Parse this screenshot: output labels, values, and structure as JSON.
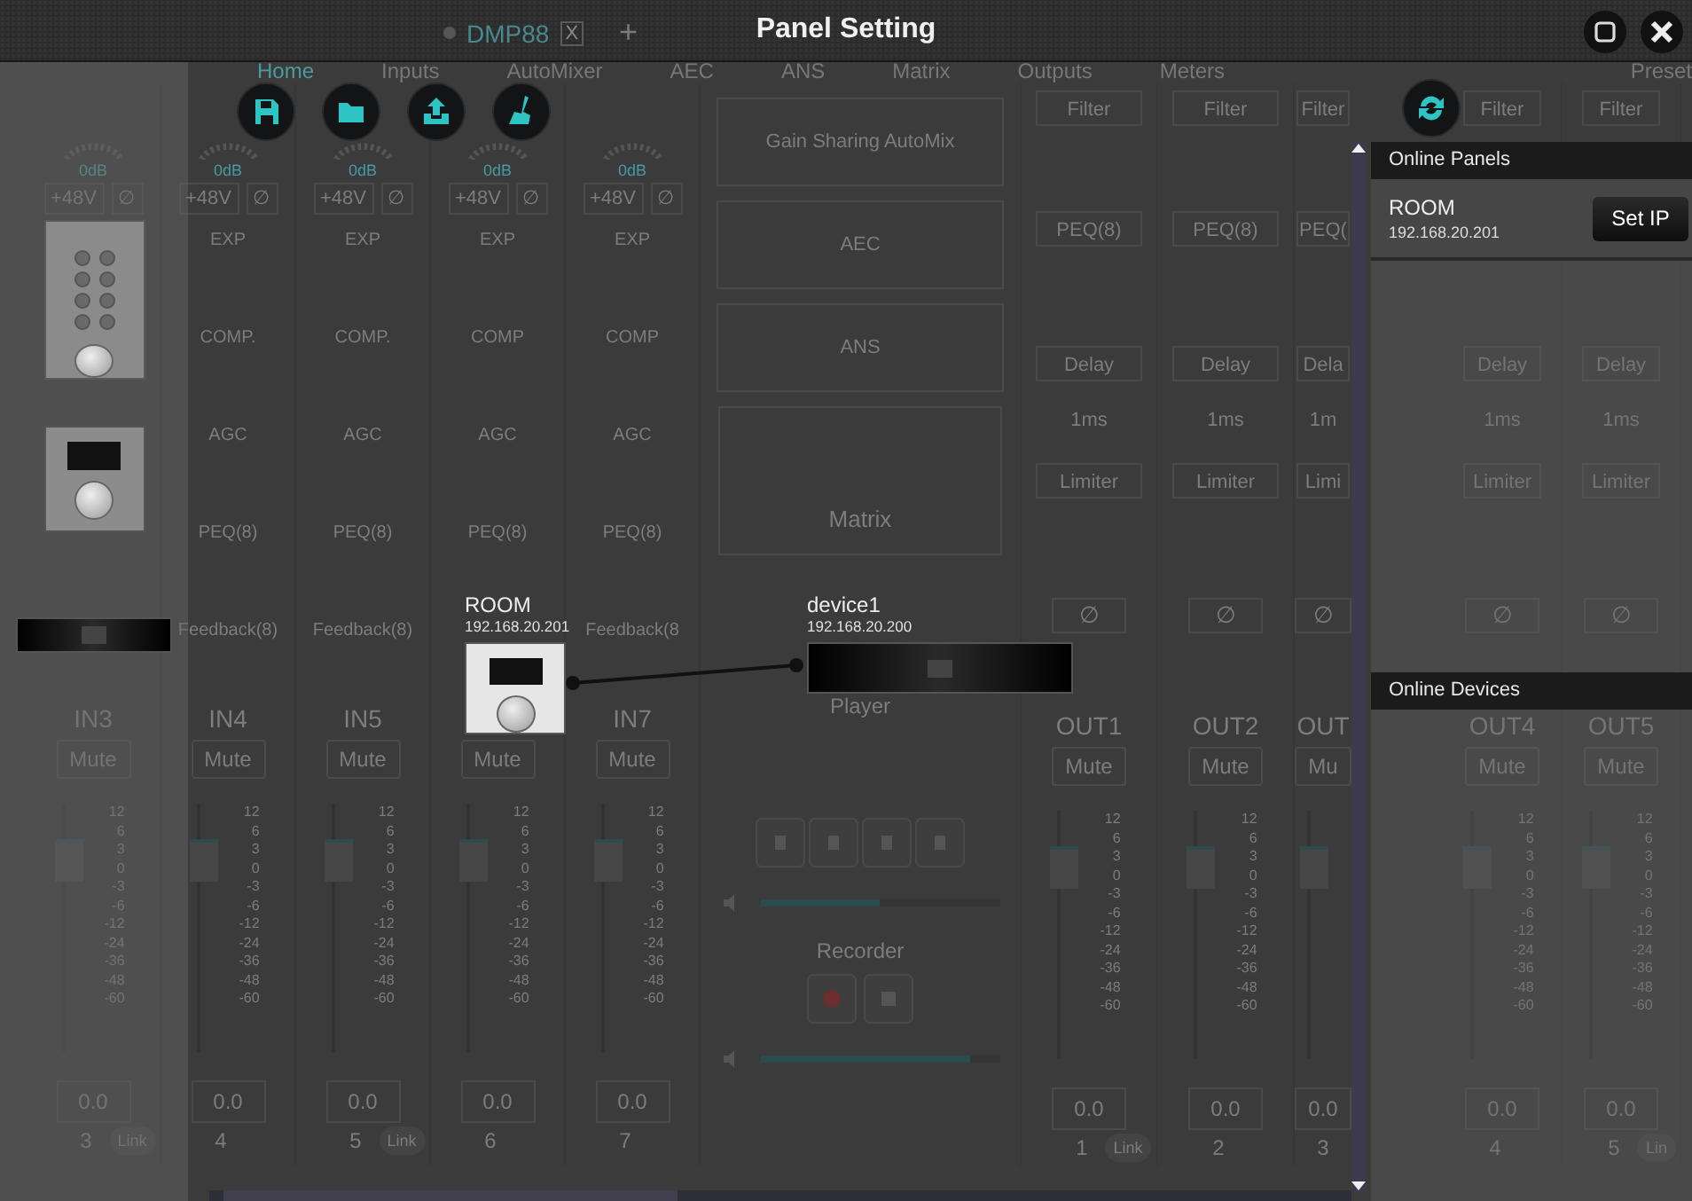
{
  "window": {
    "title": "Panel Setting"
  },
  "background_app": {
    "document_tab": {
      "label": "DMP88",
      "close": "X",
      "add": "+"
    },
    "tabs": [
      {
        "label": "Home",
        "selected": true
      },
      {
        "label": "Inputs",
        "selected": false
      },
      {
        "label": "AutoMixer",
        "selected": false
      },
      {
        "label": "AEC",
        "selected": false
      },
      {
        "label": "ANS",
        "selected": false
      },
      {
        "label": "Matrix",
        "selected": false
      },
      {
        "label": "Outputs",
        "selected": false
      },
      {
        "label": "Meters",
        "selected": false
      },
      {
        "label": "Preset",
        "selected": false
      }
    ],
    "input_strips": [
      {
        "gain": "0dB",
        "phantom": "+48V",
        "phase": "∅",
        "name": "IN3",
        "mute": "Mute",
        "scale": [
          "12",
          "6",
          "3",
          "0",
          "-3",
          "-6",
          "-12",
          "-24",
          "-36",
          "-48",
          "-60"
        ],
        "value": "0.0",
        "number": "3",
        "link": "Link"
      },
      {
        "gain": "0dB",
        "phantom": "+48V",
        "phase": "∅",
        "modules": [
          "EXP",
          "COMP.",
          "AGC",
          "PEQ(8)",
          "Feedback(8)"
        ],
        "name": "IN4",
        "mute": "Mute",
        "scale": [
          "12",
          "6",
          "3",
          "0",
          "-3",
          "-6",
          "-12",
          "-24",
          "-36",
          "-48",
          "-60"
        ],
        "value": "0.0",
        "number": "4"
      },
      {
        "gain": "0dB",
        "phantom": "+48V",
        "phase": "∅",
        "modules": [
          "EXP",
          "COMP.",
          "AGC",
          "PEQ(8)",
          "Feedback(8)"
        ],
        "name": "IN5",
        "mute": "Mute",
        "scale": [
          "12",
          "6",
          "3",
          "0",
          "-3",
          "-6",
          "-12",
          "-24",
          "-36",
          "-48",
          "-60"
        ],
        "value": "0.0",
        "number": "5",
        "link": "Link"
      },
      {
        "gain": "0dB",
        "phantom": "+48V",
        "phase": "∅",
        "modules": [
          "EXP",
          "COMP",
          "AGC",
          "PEQ(8)"
        ],
        "mute": "Mute",
        "scale": [
          "12",
          "6",
          "3",
          "0",
          "-3",
          "-6",
          "-12",
          "-24",
          "-36",
          "-48",
          "-60"
        ],
        "value": "0.0",
        "number": "6"
      },
      {
        "gain": "0dB",
        "phantom": "+48V",
        "phase": "∅",
        "modules": [
          "EXP",
          "COMP",
          "AGC",
          "PEQ(8)",
          "Feedback(8"
        ],
        "name": "IN7",
        "mute": "Mute",
        "scale": [
          "12",
          "6",
          "3",
          "0",
          "-3",
          "-6",
          "-12",
          "-24",
          "-36",
          "-48",
          "-60"
        ],
        "value": "0.0",
        "number": "7"
      }
    ],
    "center": {
      "modules": [
        "Gain Sharing AutoMix",
        "AEC",
        "ANS"
      ],
      "matrix": "Matrix",
      "player": {
        "label": "Player",
        "level": 0.5
      },
      "recorder": {
        "label": "Recorder",
        "level": 0.88
      }
    },
    "output_strips": [
      {
        "filter": "Filter",
        "peq": "PEQ(8)",
        "delay": "Delay",
        "delay_time": "1ms",
        "limiter": "Limiter",
        "phase": "∅",
        "name": "OUT1",
        "mute": "Mute",
        "scale": [
          "12",
          "6",
          "3",
          "0",
          "-3",
          "-6",
          "-12",
          "-24",
          "-36",
          "-48",
          "-60"
        ],
        "value": "0.0",
        "number": "1",
        "link": "Link"
      },
      {
        "filter": "Filter",
        "peq": "PEQ(8)",
        "delay": "Delay",
        "delay_time": "1ms",
        "limiter": "Limiter",
        "phase": "∅",
        "name": "OUT2",
        "mute": "Mute",
        "scale": [
          "12",
          "6",
          "3",
          "0",
          "-3",
          "-6",
          "-12",
          "-24",
          "-36",
          "-48",
          "-60"
        ],
        "value": "0.0",
        "number": "2"
      },
      {
        "filter": "Filter",
        "peq": "PEQ(",
        "delay": "Dela",
        "delay_time": "1m",
        "limiter": "Limi",
        "phase": "∅",
        "name": "OUT",
        "mute": "Mu",
        "value": "0.0",
        "number": "3"
      },
      {
        "filter": "Filter",
        "delay": "Delay",
        "delay_time": "1ms",
        "limiter": "Limiter",
        "phase": "∅",
        "name": "OUT4",
        "mute": "Mute",
        "scale": [
          "12",
          "6",
          "3",
          "0",
          "-3",
          "-6",
          "-12",
          "-24",
          "-36",
          "-48",
          "-60"
        ],
        "value": "0.0",
        "number": "4"
      },
      {
        "filter": "Filter",
        "delay": "Delay",
        "delay_time": "1ms",
        "limiter": "Limiter",
        "phase": "∅",
        "name": "OUT5",
        "mute": "Mute",
        "scale": [
          "12",
          "6",
          "3",
          "0",
          "-3",
          "-6",
          "-12",
          "-24",
          "-36",
          "-48",
          "-60"
        ],
        "value": "0.0",
        "number": "5",
        "link": "Lin"
      }
    ]
  },
  "palette": [
    {
      "kind": "keypad"
    },
    {
      "kind": "display"
    },
    {
      "kind": "rack"
    }
  ],
  "canvas": {
    "nodes": [
      {
        "kind": "display",
        "name": "ROOM",
        "ip": "192.168.20.201"
      },
      {
        "kind": "rack",
        "name": "device1",
        "ip": "192.168.20.200"
      }
    ]
  },
  "online_panels": {
    "title": "Online Panels",
    "items": [
      {
        "name": "ROOM",
        "ip": "192.168.20.201",
        "action": "Set IP"
      }
    ]
  },
  "online_devices": {
    "title": "Online Devices"
  }
}
